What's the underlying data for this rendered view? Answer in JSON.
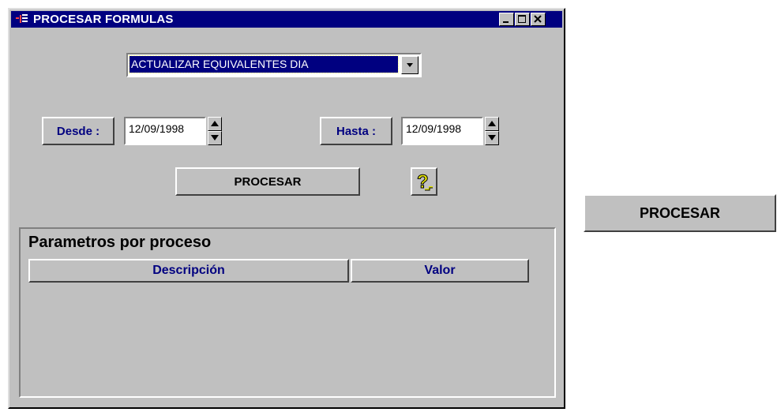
{
  "window": {
    "title": "PROCESAR FORMULAS",
    "title_bar_color": "#000080",
    "background_color": "#c0c0c0",
    "icons": [
      "app-icon",
      "minimize-icon",
      "maximize-icon",
      "close-icon"
    ]
  },
  "process_select": {
    "selected": "ACTUALIZAR EQUIVALENTES DIA"
  },
  "date_range": {
    "from_label": "Desde :",
    "from_value": "12/09/1998",
    "to_label": "Hasta :",
    "to_value": "12/09/1998"
  },
  "actions": {
    "process_label": "PROCESAR",
    "help_icon": "help-question-icon"
  },
  "parameters": {
    "title": "Parametros por proceso",
    "columns": [
      "Descripción",
      "Valor"
    ],
    "rows": []
  },
  "standalone_button": {
    "label": "PROCESAR"
  }
}
